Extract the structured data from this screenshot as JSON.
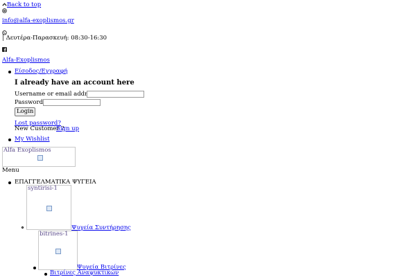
{
  "top_bar": {
    "back_to_top": "Back to top",
    "email": "info@alfa-exoplismos.gr",
    "hours": "| Δευτέρα-Παρασκευή: 08:30-16:30"
  },
  "brand": {
    "site_link": "Alfa-Exoplismos",
    "logo_alt": "Alfa Exoplismos"
  },
  "account": {
    "menu_label": "Είσοδος/Εγγραφή",
    "form_title": "I already have an account here",
    "username_label": "Username or email address *",
    "username_value": "",
    "password_label": "Password *",
    "password_value": "",
    "login_button": "Login",
    "lost_password": "Lost password?",
    "new_customer_text": "New Customer ?",
    "signup_link": "Sign up",
    "wishlist": "My Wishlist"
  },
  "menu": {
    "toggle_label": "Menu",
    "category": "ΕΠΑΓΓΕΛΜΑΤΙΚΑ ΨΥΓΕΙΑ",
    "items": [
      {
        "image_alt": "syntirisi-1",
        "label": "Ψυγεία Συντήρησης"
      },
      {
        "image_alt": "bitrines-1",
        "label": "Ψυγεία Βιτρίνες"
      }
    ],
    "sub_items": [
      "Βιτρίνες Αναψυκτικών"
    ]
  },
  "icons": {
    "back_to_top": "chevron-up-icon",
    "email": "at-sign-icon",
    "whatsapp": "whatsapp-icon",
    "facebook": "facebook-icon",
    "broken_image": "broken-image-icon"
  },
  "colors": {
    "link": "#0000ee",
    "text": "#000000",
    "image_alt_text": "#5a4a8a"
  }
}
